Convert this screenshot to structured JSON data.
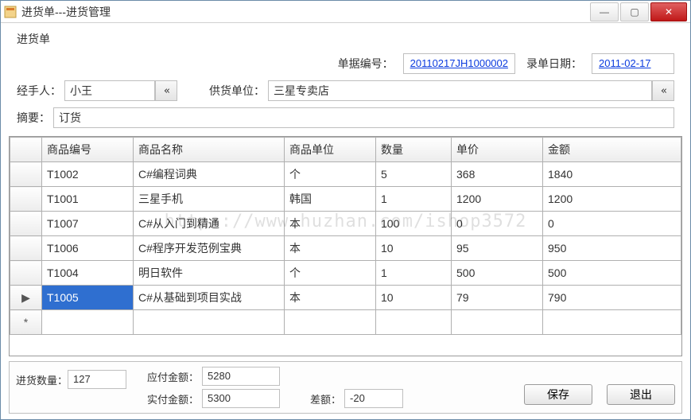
{
  "title": "进货单---进货管理",
  "group_legend": "进货单",
  "header": {
    "doc_no_label": "单据编号：",
    "doc_no": "20110217JH1000002",
    "entry_date_label": "录单日期：",
    "entry_date": "2011-02-17",
    "handler_label": "经手人：",
    "handler": "小王",
    "supplier_label": "供货单位：",
    "supplier": "三星专卖店",
    "summary_label": "摘要：",
    "summary": "订货"
  },
  "grid": {
    "columns": [
      "商品编号",
      "商品名称",
      "商品单位",
      "数量",
      "单价",
      "金额"
    ],
    "rows": [
      {
        "id": "T1002",
        "name": "C#编程词典",
        "unit": "个",
        "qty": "5",
        "price": "368",
        "amount": "1840",
        "marker": ""
      },
      {
        "id": "T1001",
        "name": "三星手机",
        "unit": "韩国",
        "qty": "1",
        "price": "1200",
        "amount": "1200",
        "marker": ""
      },
      {
        "id": "T1007",
        "name": "C#从入门到精通",
        "unit": "本",
        "qty": "100",
        "price": "0",
        "amount": "0",
        "marker": ""
      },
      {
        "id": "T1006",
        "name": "C#程序开发范例宝典",
        "unit": "本",
        "qty": "10",
        "price": "95",
        "amount": "950",
        "marker": ""
      },
      {
        "id": "T1004",
        "name": "明日软件",
        "unit": "个",
        "qty": "1",
        "price": "500",
        "amount": "500",
        "marker": ""
      },
      {
        "id": "T1005",
        "name": "C#从基础到项目实战",
        "unit": "本",
        "qty": "10",
        "price": "79",
        "amount": "790",
        "marker": "▶",
        "selected": true
      }
    ],
    "new_row_marker": "*"
  },
  "footer": {
    "qty_label": "进货数量：",
    "qty": "127",
    "due_label": "应付金额：",
    "due": "5280",
    "paid_label": "实付金额：",
    "paid": "5300",
    "diff_label": "差额：",
    "diff": "-20",
    "save": "保存",
    "exit": "退出"
  },
  "watermark": "https://www.huzhan.com/ishop3572"
}
